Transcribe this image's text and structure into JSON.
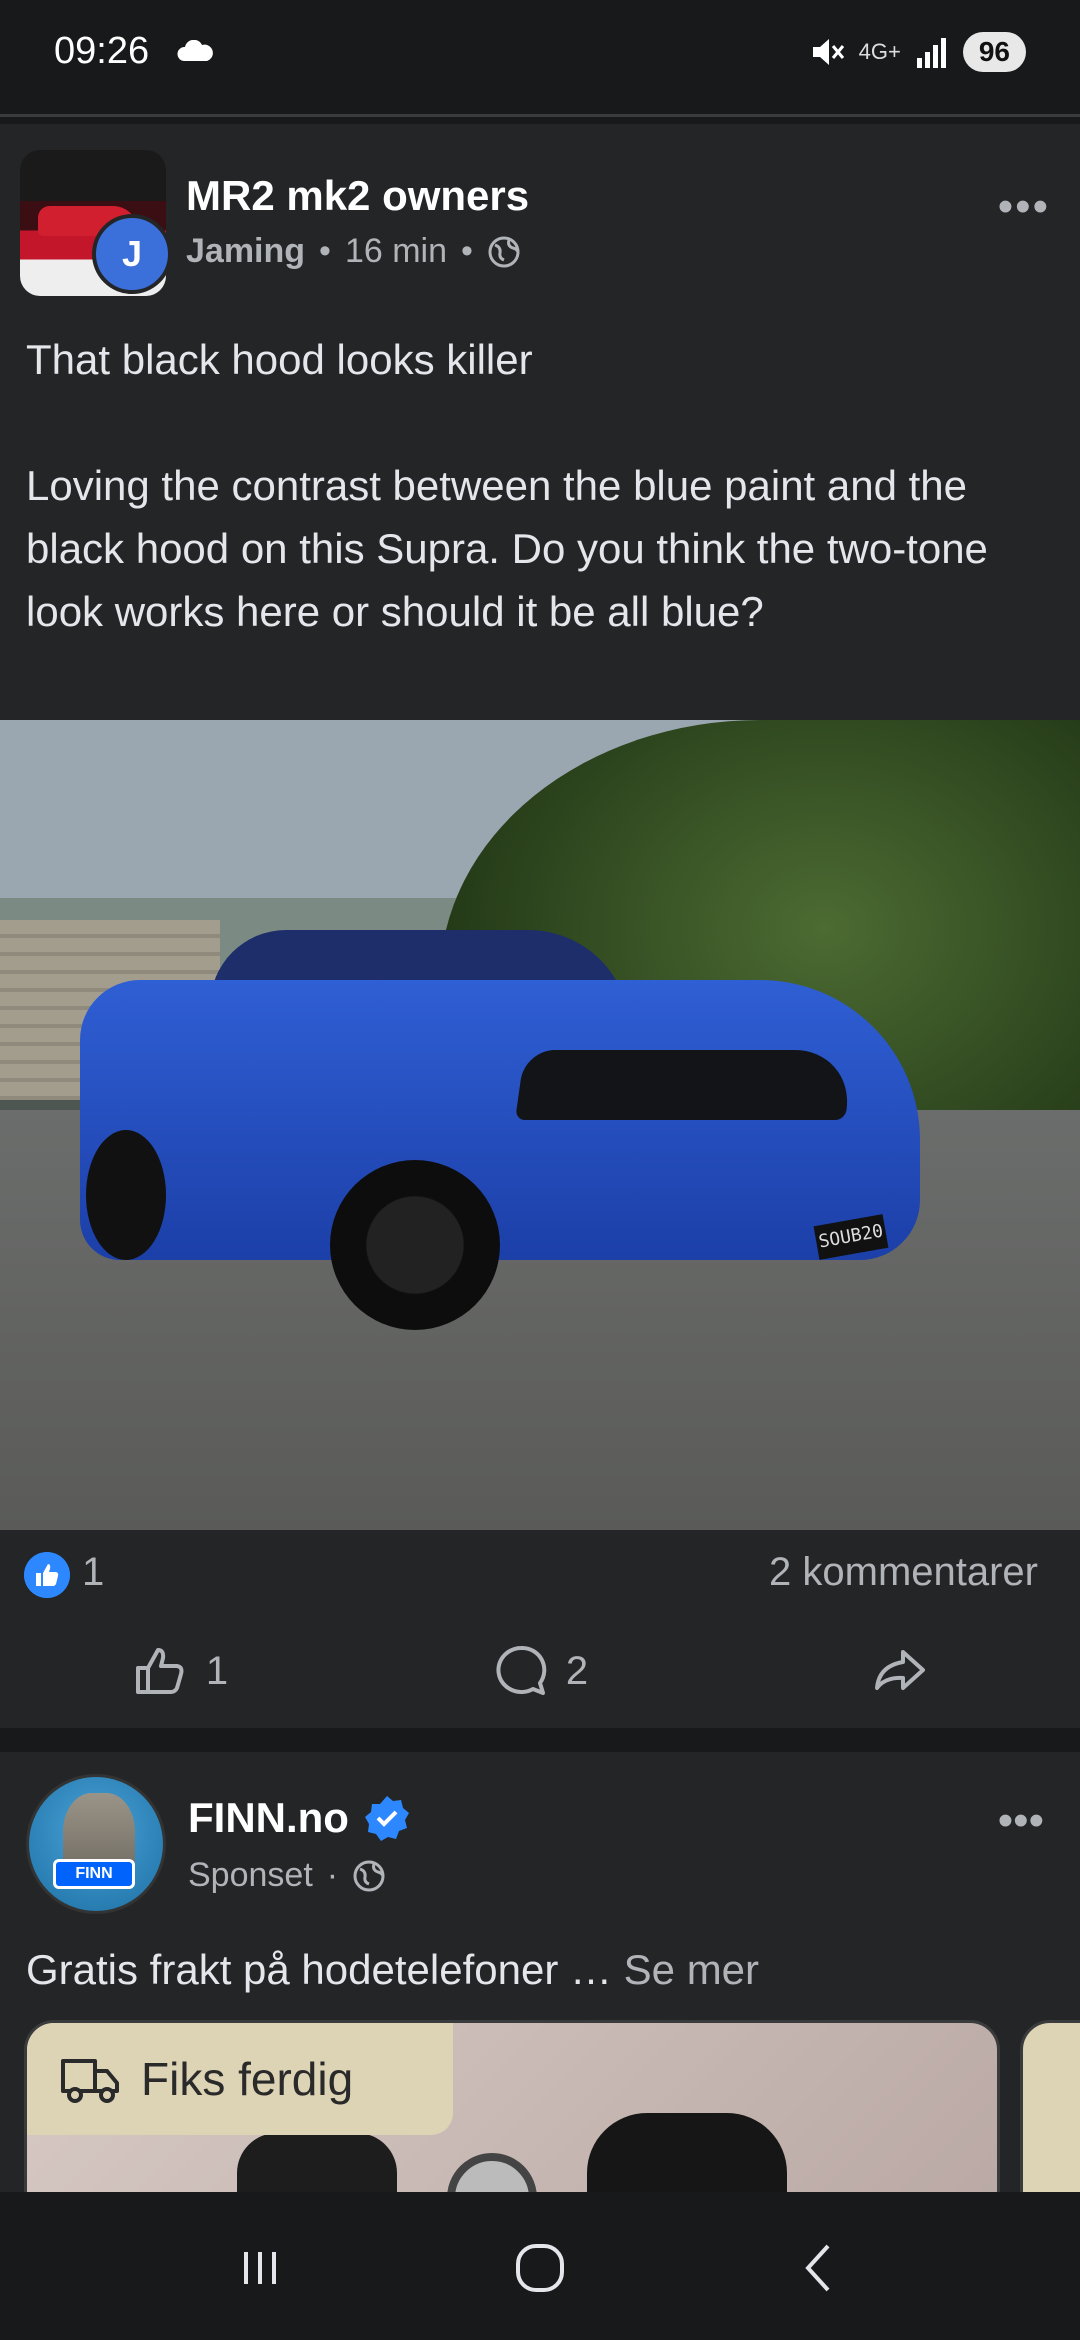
{
  "status_bar": {
    "time": "09:26",
    "network": "4G+",
    "battery": "96"
  },
  "post": {
    "group_name": "MR2 mk2 owners",
    "author": "Jaming",
    "author_initial": "J",
    "time": "16 min",
    "separator": "•",
    "title": "That black hood looks killer",
    "body": "Loving the contrast between the blue paint and the black hood on this Supra. Do you think the two-tone look works here or should it be all blue?",
    "plate": "SOUB20",
    "like_count": "1",
    "comments_label": "2 kommentarer",
    "actions": {
      "like_count": "1",
      "comment_count": "2"
    }
  },
  "ad": {
    "advertiser": "FINN.no",
    "sponsored_label": "Sponset",
    "separator": "·",
    "text": "Gratis frakt på hodetelefoner …",
    "see_more": "Se mer",
    "badge_label": "Fiks ferdig",
    "avatar_tag": "FINN"
  },
  "colors": {
    "background": "#18191a",
    "card": "#242526",
    "accent_blue": "#2d88ff",
    "text_secondary": "#b0b3b8"
  },
  "icons": [
    "cloud-icon",
    "mute-icon",
    "signal-icon",
    "globe-icon",
    "more-icon",
    "like-reaction-icon",
    "thumbs-up-icon",
    "comment-icon",
    "share-icon",
    "verified-icon",
    "truck-icon",
    "recents-icon",
    "home-icon",
    "back-icon"
  ]
}
